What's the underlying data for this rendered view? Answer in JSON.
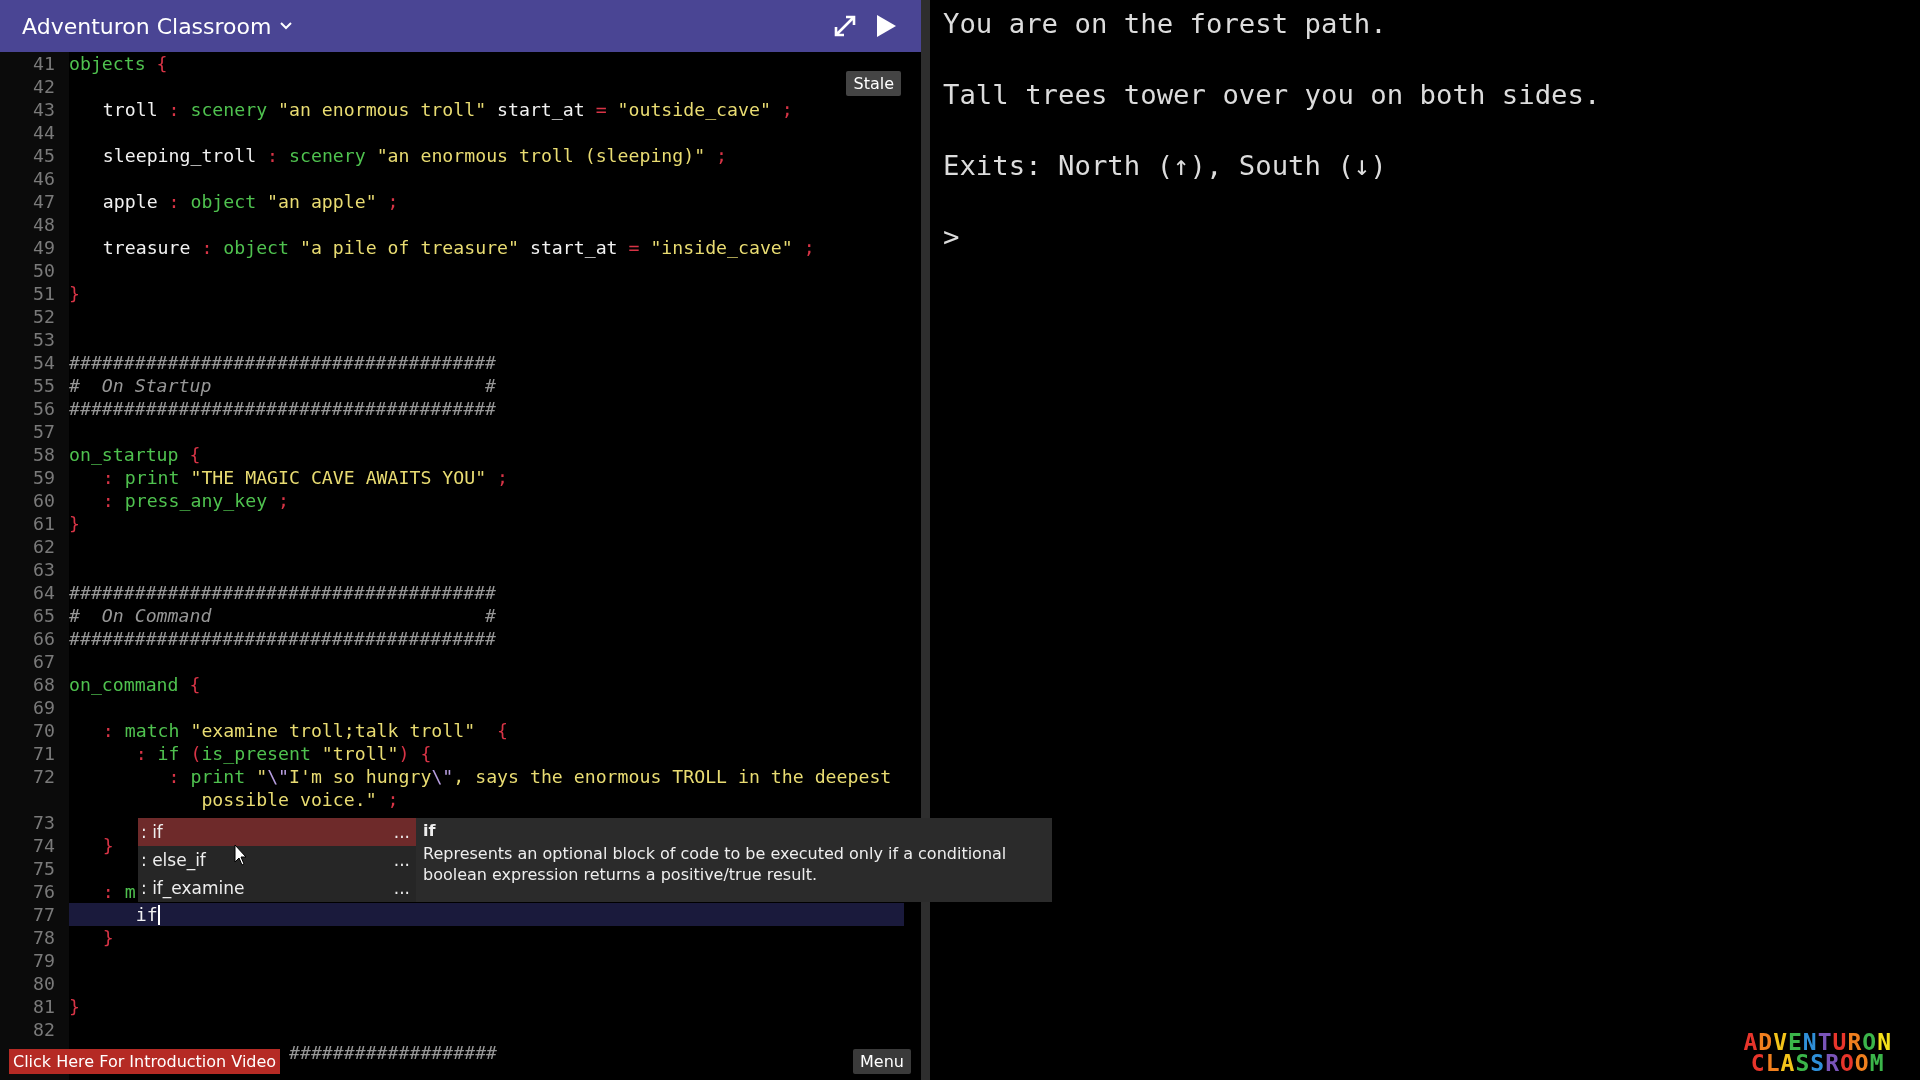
{
  "header": {
    "title": "Adventuron Classroom"
  },
  "editor": {
    "badge": "Stale",
    "lines": [
      {
        "number": "41",
        "current": false,
        "tokens": [
          {
            "text": "objects",
            "kind": "keyword"
          },
          {
            "text": " {",
            "kind": "punct"
          }
        ]
      },
      {
        "number": "42",
        "current": false
      },
      {
        "number": "43",
        "current": false,
        "tokens": [
          {
            "text": "   troll",
            "kind": "ident"
          },
          {
            "text": " :",
            "kind": "punct"
          },
          {
            "text": " scenery",
            "kind": "keyword"
          },
          {
            "text": " \"an enormous troll\"",
            "kind": "string"
          },
          {
            "text": " start_at",
            "kind": "ident"
          },
          {
            "text": " =",
            "kind": "punct"
          },
          {
            "text": " \"outside_cave\"",
            "kind": "string"
          },
          {
            "text": " ;",
            "kind": "punct"
          }
        ]
      },
      {
        "number": "44",
        "current": false
      },
      {
        "number": "45",
        "current": false,
        "tokens": [
          {
            "text": "   sleeping_troll",
            "kind": "ident"
          },
          {
            "text": " :",
            "kind": "punct"
          },
          {
            "text": " scenery",
            "kind": "keyword"
          },
          {
            "text": " \"an enormous troll (sleeping)\"",
            "kind": "string"
          },
          {
            "text": " ;",
            "kind": "punct"
          }
        ]
      },
      {
        "number": "46",
        "current": false
      },
      {
        "number": "47",
        "current": false,
        "tokens": [
          {
            "text": "   apple",
            "kind": "ident"
          },
          {
            "text": " :",
            "kind": "punct"
          },
          {
            "text": " object",
            "kind": "keyword"
          },
          {
            "text": " \"an apple\"",
            "kind": "string"
          },
          {
            "text": " ;",
            "kind": "punct"
          }
        ]
      },
      {
        "number": "48",
        "current": false
      },
      {
        "number": "49",
        "current": false,
        "tokens": [
          {
            "text": "   treasure",
            "kind": "ident"
          },
          {
            "text": " :",
            "kind": "punct"
          },
          {
            "text": " object",
            "kind": "keyword"
          },
          {
            "text": " \"a pile of treasure\"",
            "kind": "string"
          },
          {
            "text": " start_at",
            "kind": "ident"
          },
          {
            "text": " =",
            "kind": "punct"
          },
          {
            "text": " \"inside_cave\"",
            "kind": "string"
          },
          {
            "text": " ;",
            "kind": "punct"
          }
        ]
      },
      {
        "number": "50",
        "current": false
      },
      {
        "number": "51",
        "current": false,
        "tokens": [
          {
            "text": "}",
            "kind": "punct"
          }
        ]
      },
      {
        "number": "52",
        "current": false
      },
      {
        "number": "53",
        "current": false
      },
      {
        "number": "54",
        "current": false,
        "tokens": [
          {
            "text": "#######################################",
            "kind": "comment"
          }
        ]
      },
      {
        "number": "55",
        "current": false,
        "tokens": [
          {
            "text": "#  On Startup                         #",
            "kind": "comment"
          }
        ]
      },
      {
        "number": "56",
        "current": false,
        "tokens": [
          {
            "text": "#######################################",
            "kind": "comment"
          }
        ]
      },
      {
        "number": "57",
        "current": false
      },
      {
        "number": "58",
        "current": false,
        "tokens": [
          {
            "text": "on_startup",
            "kind": "keyword"
          },
          {
            "text": " {",
            "kind": "punct"
          }
        ]
      },
      {
        "number": "59",
        "current": false,
        "tokens": [
          {
            "text": "   :",
            "kind": "punct"
          },
          {
            "text": " print",
            "kind": "keyword"
          },
          {
            "text": " \"THE MAGIC CAVE AWAITS YOU\"",
            "kind": "string"
          },
          {
            "text": " ;",
            "kind": "punct"
          }
        ]
      },
      {
        "number": "60",
        "current": false,
        "tokens": [
          {
            "text": "   :",
            "kind": "punct"
          },
          {
            "text": " press_any_key",
            "kind": "keyword"
          },
          {
            "text": " ;",
            "kind": "punct"
          }
        ]
      },
      {
        "number": "61",
        "current": false,
        "tokens": [
          {
            "text": "}",
            "kind": "punct"
          }
        ]
      },
      {
        "number": "62",
        "current": false
      },
      {
        "number": "63",
        "current": false
      },
      {
        "number": "64",
        "current": false,
        "tokens": [
          {
            "text": "#######################################",
            "kind": "comment"
          }
        ]
      },
      {
        "number": "65",
        "current": false,
        "tokens": [
          {
            "text": "#  On Command                         #",
            "kind": "comment"
          }
        ]
      },
      {
        "number": "66",
        "current": false,
        "tokens": [
          {
            "text": "#######################################",
            "kind": "comment"
          }
        ]
      },
      {
        "number": "67",
        "current": false
      },
      {
        "number": "68",
        "current": false,
        "tokens": [
          {
            "text": "on_command",
            "kind": "keyword"
          },
          {
            "text": " {",
            "kind": "punct"
          }
        ]
      },
      {
        "number": "69",
        "current": false
      },
      {
        "number": "70",
        "current": false,
        "tokens": [
          {
            "text": "   :",
            "kind": "punct"
          },
          {
            "text": " match",
            "kind": "keyword"
          },
          {
            "text": " \"examine troll;talk troll\"",
            "kind": "string"
          },
          {
            "text": "  {",
            "kind": "punct"
          }
        ]
      },
      {
        "number": "71",
        "current": false,
        "tokens": [
          {
            "text": "      :",
            "kind": "punct"
          },
          {
            "text": " if",
            "kind": "keyword"
          },
          {
            "text": " (",
            "kind": "punct"
          },
          {
            "text": "is_present",
            "kind": "keyword"
          },
          {
            "text": " \"troll\"",
            "kind": "string"
          },
          {
            "text": ") {",
            "kind": "punct"
          }
        ]
      },
      {
        "number": "72",
        "current": false,
        "tokens": [
          {
            "text": "         :",
            "kind": "punct"
          },
          {
            "text": " print",
            "kind": "keyword"
          },
          {
            "text": " \"",
            "kind": "string"
          },
          {
            "text": "\\\"",
            "kind": "escape"
          },
          {
            "text": "I'm so hungry",
            "kind": "string"
          },
          {
            "text": "\\\"",
            "kind": "escape"
          },
          {
            "text": ", says the enormous TROLL in the deepest",
            "kind": "string"
          }
        ],
        "continuation": [
          {
            "text": "            possible voice.\"",
            "kind": "string"
          },
          {
            "text": " ;",
            "kind": "punct"
          }
        ]
      },
      {
        "number": "73",
        "current": false
      },
      {
        "number": "74",
        "current": false,
        "tokens": [
          {
            "text": "   }",
            "kind": "punct"
          }
        ]
      },
      {
        "number": "75",
        "current": false
      },
      {
        "number": "76",
        "current": false,
        "tokens": [
          {
            "text": "   :",
            "kind": "punct"
          },
          {
            "text": " m",
            "kind": "keyword"
          }
        ]
      },
      {
        "number": "77",
        "current": true,
        "tokens": [
          {
            "text": "      if",
            "kind": "ident"
          }
        ]
      },
      {
        "number": "78",
        "current": false,
        "tokens": [
          {
            "text": "   }",
            "kind": "punct"
          }
        ]
      },
      {
        "number": "79",
        "current": false
      },
      {
        "number": "80",
        "current": false
      },
      {
        "number": "81",
        "current": false,
        "tokens": [
          {
            "text": "}",
            "kind": "punct"
          }
        ]
      },
      {
        "number": "82",
        "current": false
      },
      {
        "current": false,
        "tokens": [
          {
            "text": "                    ###################",
            "kind": "comment"
          }
        ]
      }
    ]
  },
  "autocomplete": {
    "items": [
      {
        "label": ": if",
        "more": "...",
        "selected": true
      },
      {
        "label": ": else_if",
        "more": "...",
        "selected": false
      },
      {
        "label": ": if_examine",
        "more": "...",
        "selected": false
      }
    ],
    "detail": {
      "title": "if",
      "description": "Represents an optional block of code to be executed only if a conditional boolean expression returns a positive/true result."
    }
  },
  "intro_button": "Click Here For Introduction Video",
  "menu_button": "Menu",
  "game": {
    "lines": [
      "You are on the forest path.",
      "Tall trees tower over you on both sides.",
      "Exits: North (↑), South (↓)"
    ],
    "prompt": ">"
  },
  "logo": {
    "lines": [
      "ADVENTURON",
      "CLASSROOM"
    ]
  }
}
